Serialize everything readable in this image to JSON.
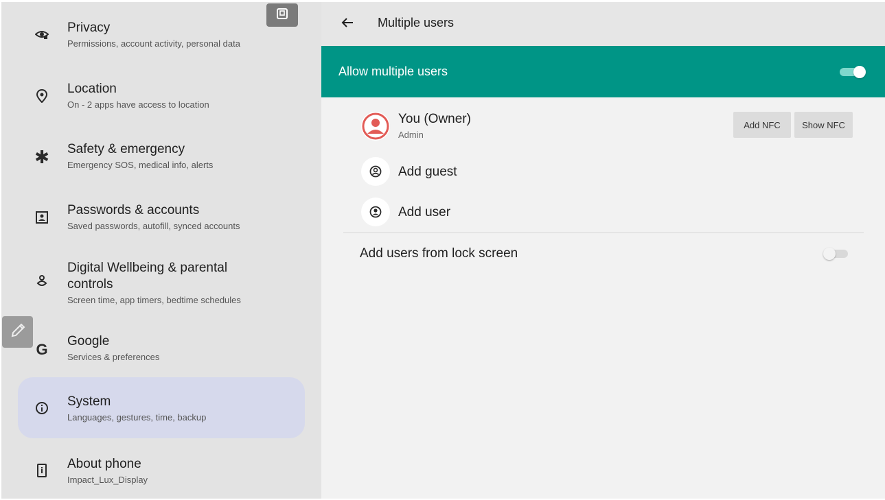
{
  "sidebar": {
    "items": [
      {
        "title": "Privacy",
        "subtitle": "Permissions, account activity, personal data",
        "icon": "privacy-eye-icon"
      },
      {
        "title": "Location",
        "subtitle": "On - 2 apps have access to location",
        "icon": "location-pin-icon"
      },
      {
        "title": "Safety & emergency",
        "subtitle": "Emergency SOS, medical info, alerts",
        "icon": "asterisk-icon"
      },
      {
        "title": "Passwords & accounts",
        "subtitle": "Saved passwords, autofill, synced accounts",
        "icon": "account-box-icon"
      },
      {
        "title": "Digital Wellbeing & parental",
        "title2": "controls",
        "subtitle": "Screen time, app timers, bedtime schedules",
        "icon": "wellbeing-icon"
      },
      {
        "title": "Google",
        "subtitle": "Services & preferences",
        "icon": "google-g-icon"
      },
      {
        "title": "System",
        "subtitle": "Languages, gestures, time, backup",
        "icon": "info-icon",
        "selected": true
      },
      {
        "title": "About phone",
        "subtitle": "Impact_Lux_Display",
        "icon": "phone-icon"
      }
    ]
  },
  "header": {
    "title": "Multiple users"
  },
  "banner": {
    "label": "Allow multiple users",
    "toggle_on": true
  },
  "users": {
    "owner": {
      "name": "You (Owner)",
      "role": "Admin"
    },
    "add_nfc": "Add NFC",
    "show_nfc": "Show NFC",
    "add_guest": "Add guest",
    "add_user": "Add user"
  },
  "lock_screen": {
    "label": "Add users from lock screen",
    "toggle_on": false
  },
  "colors": {
    "accent": "#009586",
    "selected_bg": "#d6d9ec",
    "owner_avatar": "#e25b56"
  }
}
